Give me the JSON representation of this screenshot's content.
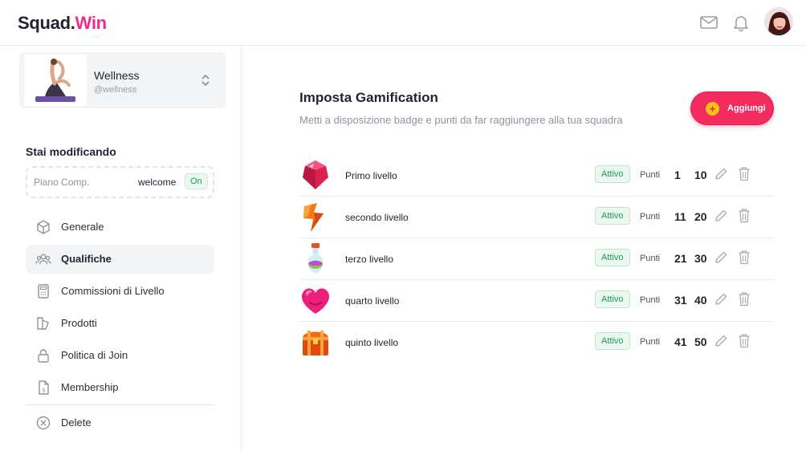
{
  "header": {
    "logo_main": "Squad",
    "logo_dot": ".",
    "logo_accent": "Win",
    "brand_color": "#ec2d8f",
    "icons": [
      "mail-icon",
      "bell-icon",
      "user-avatar"
    ]
  },
  "sidebar": {
    "profile": {
      "name": "Wellness",
      "handle": "@wellness"
    },
    "editing_title": "Stai modificando",
    "plan": {
      "label": "Piano Comp.",
      "code": "welcome",
      "status": "On"
    },
    "items": [
      {
        "label": "Generale",
        "icon": "cube-icon",
        "active": false
      },
      {
        "label": "Qualifiche",
        "icon": "users-icon",
        "active": true
      },
      {
        "label": "Commissioni di Livello",
        "icon": "calculator-icon",
        "active": false
      },
      {
        "label": "Prodotti",
        "icon": "product-icon",
        "active": false
      },
      {
        "label": "Politica di Join",
        "icon": "lock-icon",
        "active": false
      },
      {
        "label": "Membership",
        "icon": "dollar-document-icon",
        "active": false
      }
    ],
    "delete_label": "Delete"
  },
  "main": {
    "title": "Imposta Gamification",
    "subtitle": "Metti a disposizione badge e punti da far raggiungere alla tua squadra",
    "add_label": "Aggiungi",
    "accent_color": "#f32b5e",
    "levels": [
      {
        "name": "Primo livello",
        "status": "Attivo",
        "points_label": "Punti",
        "from": "1",
        "to": "10",
        "icon": "ruby-gem-icon"
      },
      {
        "name": "secondo livello",
        "status": "Attivo",
        "points_label": "Punti",
        "from": "11",
        "to": "20",
        "icon": "lightning-icon"
      },
      {
        "name": "terzo livello",
        "status": "Attivo",
        "points_label": "Punti",
        "from": "21",
        "to": "30",
        "icon": "potion-icon"
      },
      {
        "name": "quarto livello",
        "status": "Attivo",
        "points_label": "Punti",
        "from": "31",
        "to": "40",
        "icon": "heart-icon"
      },
      {
        "name": "quinto livello",
        "status": "Attivo",
        "points_label": "Punti",
        "from": "41",
        "to": "50",
        "icon": "treasure-chest-icon"
      }
    ]
  }
}
